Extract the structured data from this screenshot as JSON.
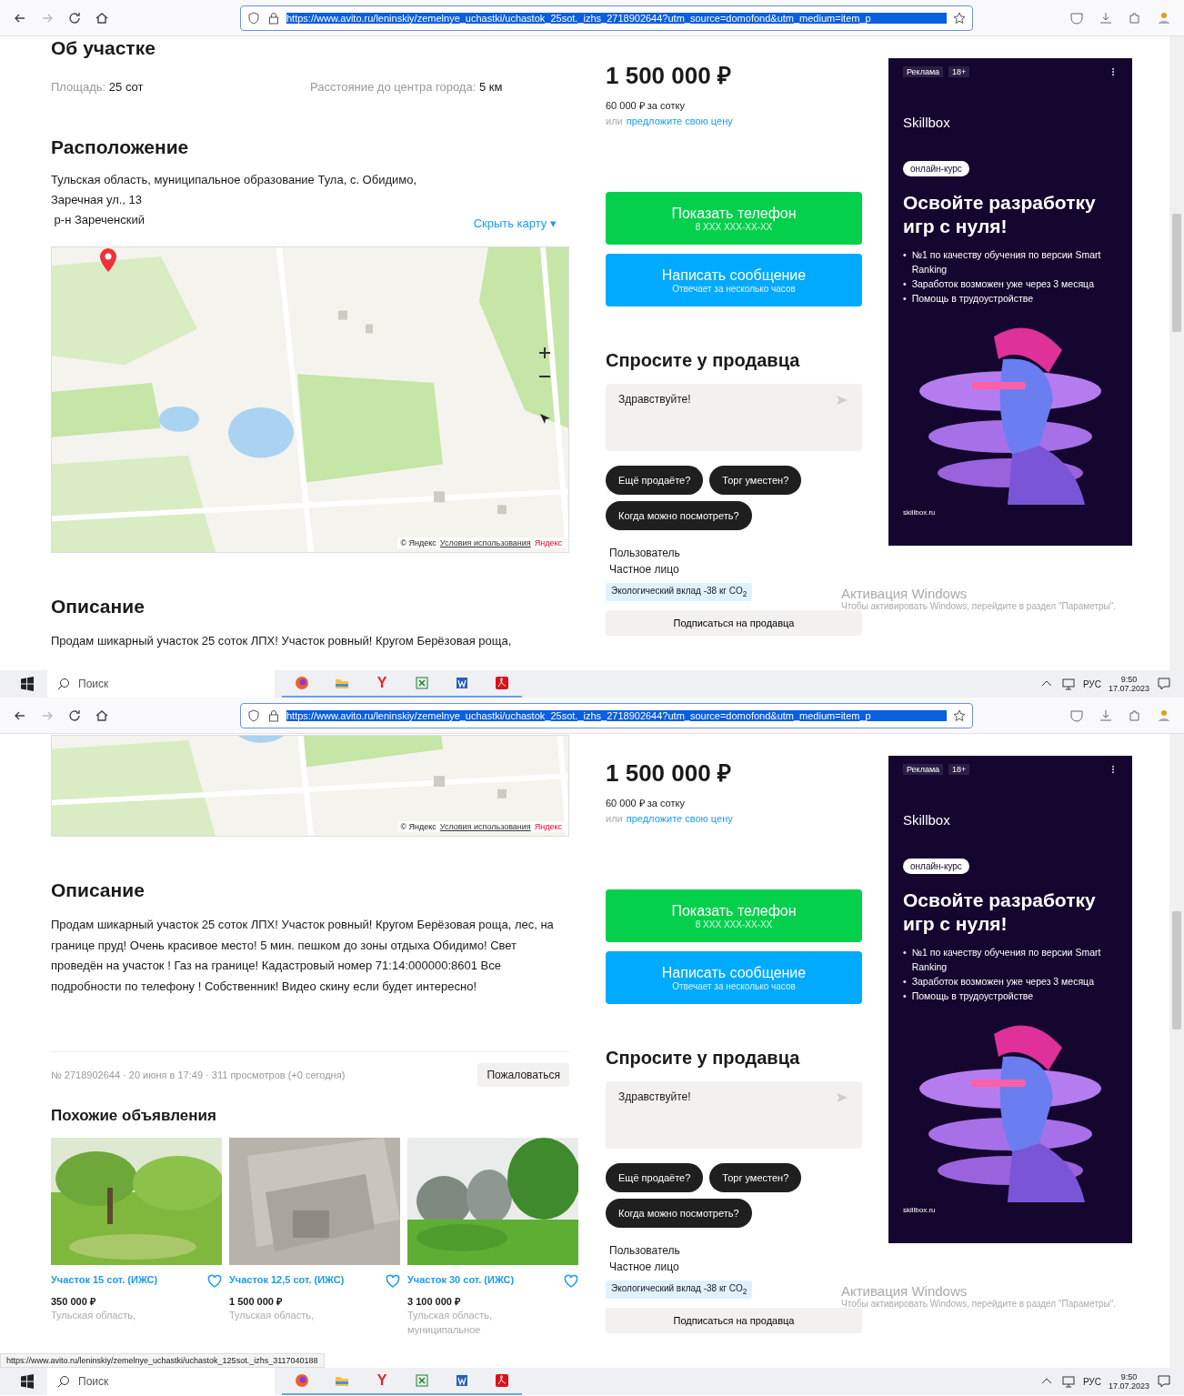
{
  "screens": [
    {
      "browser": {
        "url": "https://www.avito.ru/leninskiy/zemelnye_uchastki/uchastok_25sot._izhs_2718902644?utm_source=domofond&utm_medium=item_p"
      },
      "left": [
        {
          "kind": "top_heading",
          "text": "Об участке"
        },
        {
          "kind": "params",
          "items": [
            {
              "label": "Площадь:",
              "value": "25 сот"
            },
            {
              "label": "Расстояние до центра города:",
              "value": "5 км"
            }
          ]
        },
        {
          "kind": "heading",
          "text": "Расположение"
        },
        {
          "kind": "address",
          "lines": [
            "Тульская область, муниципальное образование Тула, с. Обидимо,",
            "Заречная ул., 13",
            " р-н Зареченский"
          ],
          "toggle": "Скрыть карту",
          "toggle_caret": "▾"
        },
        {
          "kind": "map",
          "copyright": "© Яндекс",
          "terms": "Условия использования",
          "brand": "Яндекс",
          "pin": true
        },
        {
          "kind": "heading",
          "text": "Описание"
        },
        {
          "kind": "text",
          "text": "Продам шикарный участок 25 соток ЛПХ! Участок ровный! Кругом Берёзовая роща,"
        }
      ],
      "seller": {
        "price": "1 500 000 ₽",
        "per_unit": "60 000 ₽ за сотку",
        "offer_prefix": "или",
        "offer_link": "предложите свою цену",
        "buttons": [
          {
            "kind": "phone",
            "title": "Показать телефон",
            "subtitle": "8 XXX XXX-XX-XX"
          },
          {
            "kind": "message",
            "title": "Написать сообщение",
            "subtitle": "Отвечает за несколько часов"
          }
        ],
        "ask_title": "Спросите у продавца",
        "message": "Здравствуйте!",
        "chips": [
          "Ещё продаёте?",
          "Торг уместен?",
          "Когда можно посмотреть?"
        ],
        "user_role": "Пользователь",
        "user_type": "Частное лицо",
        "eco": "Экологический вклад -38 кг CO$_{2}$",
        "subscribe": "Подписаться на продавца"
      },
      "ad": {
        "label": "Реклама",
        "age": "18+",
        "brand": "Skillbox",
        "badge": "онлайн-курс",
        "headline": "Освойте разработку игр с нуля!",
        "bullets": [
          {
            "marker": "•",
            "text": "№1 по качеству обучения по версии Smart Ranking"
          },
          {
            "marker": "•",
            "text": "Заработок возможен уже через 3 месяца"
          },
          {
            "marker": "•",
            "text": "Помощь в трудоустройстве"
          }
        ],
        "domain": "skillbox.ru"
      },
      "activation": {
        "title": "Активация Windows",
        "text": "Чтобы активировать Windows, перейдите в раздел \"Параметры\"."
      },
      "taskbar": {
        "search": "Поиск",
        "apps": [
          {
            "kind": "fox"
          },
          {
            "kind": "folder"
          },
          {
            "kind": "letter",
            "text": "Y"
          },
          {
            "kind": "sheet"
          },
          {
            "kind": "doc"
          },
          {
            "kind": "pdf"
          }
        ],
        "lang": "РУС",
        "time": "9:50",
        "date": "17.07.2023"
      }
    },
    {
      "browser": {
        "url": "https://www.avito.ru/leninskiy/zemelnye_uchastki/uchastok_25sot._izhs_2718902644?utm_source=domofond&utm_medium=item_p"
      },
      "left": [
        {
          "kind": "map_tail",
          "copyright": "© Яндекс",
          "terms": "Условия использования",
          "brand": "Яндекс",
          "pin": false
        },
        {
          "kind": "heading",
          "text": "Описание"
        },
        {
          "kind": "text",
          "text": "Продам шикарный участок 25 соток ЛПХ! Участок ровный! Кругом Берёзовая роща, лес, на границе пруд! Очень красивое место! 5 мин. пешком до зоны отдыха Обидимо! Свет проведён на участок ! Газ на границе! Кадастровый номер 71:14:000000:8601 Все подробности по телефону ! Собственник! Видео скину если будет интересно!"
        },
        {
          "kind": "meta",
          "text": "№ 2718902644 · 20 июня в 17:49 · 311 просмотров (+0 сегодня)",
          "button": "Пожаловаться"
        },
        {
          "kind": "similar",
          "title": "Похожие объявления",
          "cards": [
            {
              "title": "Участок 15 сот. (ИЖС)",
              "price": "350 000 ₽",
              "location": [
                "Тульская область,"
              ]
            },
            {
              "title": "Участок 12,5 сот. (ИЖС)",
              "price": "1 500 000 ₽",
              "location": [
                "Тульская область,"
              ]
            },
            {
              "title": "Участок 30 сот. (ИЖС)",
              "price": "3 100 000 ₽",
              "location": [
                "Тульская область,",
                "муниципальное"
              ]
            }
          ]
        }
      ],
      "seller": {
        "price": "1 500 000 ₽",
        "per_unit": "60 000 ₽ за сотку",
        "offer_prefix": "или",
        "offer_link": "предложите свою цену",
        "buttons": [
          {
            "kind": "phone",
            "title": "Показать телефон",
            "subtitle": "8 XXX XXX-XX-XX"
          },
          {
            "kind": "message",
            "title": "Написать сообщение",
            "subtitle": "Отвечает за несколько часов"
          }
        ],
        "ask_title": "Спросите у продавца",
        "message": "Здравствуйте!",
        "chips": [
          "Ещё продаёте?",
          "Торг уместен?",
          "Когда можно посмотреть?"
        ],
        "user_role": "Пользователь",
        "user_type": "Частное лицо",
        "eco": "Экологический вклад -38 кг CO$_{2}$",
        "subscribe": "Подписаться на продавца"
      },
      "ad": {
        "label": "Реклама",
        "age": "18+",
        "brand": "Skillbox",
        "badge": "онлайн-курс",
        "headline": "Освойте разработку игр с нуля!",
        "bullets": [
          {
            "marker": "•",
            "text": "№1 по качеству обучения по версии Smart Ranking"
          },
          {
            "marker": "•",
            "text": "Заработок возможен уже через 3 месяца"
          },
          {
            "marker": "•",
            "text": "Помощь в трудоустройстве"
          }
        ],
        "domain": "skillbox.ru"
      },
      "activation": {
        "title": "Активация Windows",
        "text": "Чтобы активировать Windows, перейдите в раздел \"Параметры\"."
      },
      "status_url": "https://www.avito.ru/leninskiy/zemelnye_uchastki/uchastok_125sot._izhs_3117040188",
      "taskbar": {
        "search": "Поиск",
        "apps": [
          {
            "kind": "fox"
          },
          {
            "kind": "folder"
          },
          {
            "kind": "letter",
            "text": "Y"
          },
          {
            "kind": "sheet"
          },
          {
            "kind": "doc"
          },
          {
            "kind": "pdf"
          }
        ],
        "lang": "РУС",
        "time": "9:50",
        "date": "17.07.2023"
      }
    }
  ]
}
